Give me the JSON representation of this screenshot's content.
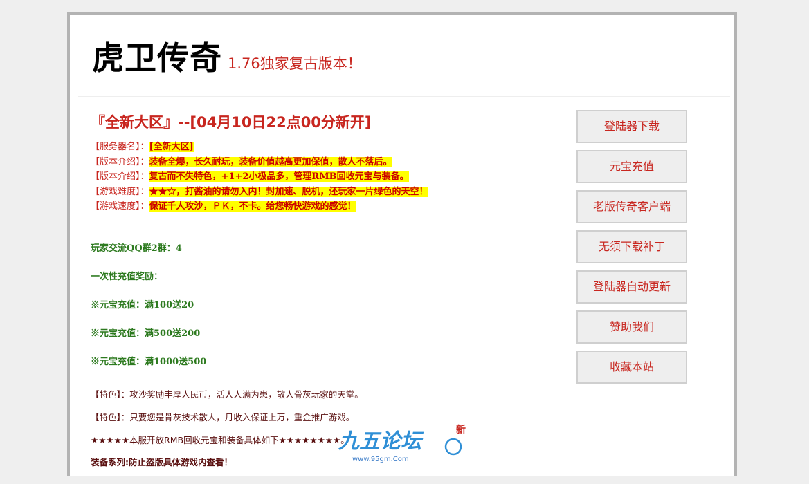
{
  "header": {
    "site_title": "虎卫传奇",
    "tagline": "1.76独家复古版本！"
  },
  "main": {
    "server_heading": "『全新大区』--[04月10日22点00分新开]",
    "info": [
      {
        "label": "【服务器名】：",
        "value": "[全新大区]"
      },
      {
        "label": "【版本介绍】：",
        "value": "装备全爆，长久耐玩，装备价值越高更加保值，散人不落后。"
      },
      {
        "label": "【版本介绍】：",
        "value": "复古而不失特色，+1+2小极品多，管理RMB回收元宝与装备。"
      },
      {
        "label": "【游戏难度】：",
        "value": "★★☆，打酱油的请勿入内！封加速、脱机，还玩家一片绿色的天空！"
      },
      {
        "label": "【游戏速度】：",
        "value": "保证千人攻沙，ＰＫ，不卡。给您畅快游戏的感觉！"
      }
    ],
    "qq_group": "玩家交流QQ群2群：4",
    "recharge_title": "一次性充值奖励：",
    "recharge_items": [
      "※元宝充值：满100送20",
      "※元宝充值：满500送200",
      "※元宝充值：满1000送500"
    ],
    "features": [
      "【特色】：攻沙奖励丰厚人民币，活人人满为患，散人骨灰玩家的天堂。",
      "【特色】：只要您是骨灰技术散人，月收入保证上万，重金推广游戏。"
    ],
    "rmb_notice": "★★★★★本服开放RMB回收元宝和装备具体如下★★★★★★★★。",
    "equipment_note": "装备系列:防止盗版具体游戏内查看！"
  },
  "sidebar": {
    "buttons": [
      "登陆器下载",
      "元宝充值",
      "老版传奇客户端",
      "无须下载补丁",
      "登陆器自动更新",
      "赞助我们",
      "收藏本站"
    ]
  },
  "watermark": {
    "logo_text": "九五论坛",
    "badge": "新",
    "url": "www.95gm.Com"
  },
  "colors": {
    "accent_red": "#c8261f",
    "highlight_yellow": "#ffff00",
    "green_text": "#2d7a1f",
    "button_bg": "#eeeeee"
  }
}
